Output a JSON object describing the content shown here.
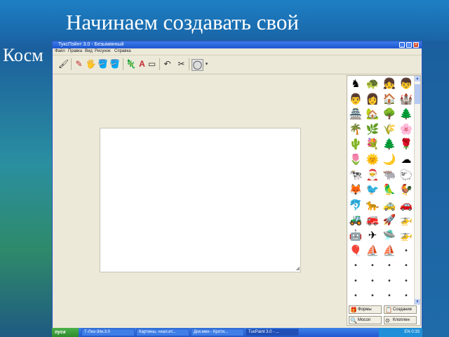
{
  "slide": {
    "title_line1": "Начинаем создавать свой",
    "title_line2": "Косм"
  },
  "window": {
    "title": "ТуксПэйнт 3.0 - Безымянный",
    "menu": [
      "Файл",
      "Правка",
      "Вид",
      "Рисунок",
      "Справка"
    ]
  },
  "toolbar": {
    "tools": [
      {
        "icon": "🖌",
        "name": "brush-tool"
      },
      {
        "icon": "✎",
        "name": "pencil-tool"
      },
      {
        "icon": "🖐",
        "name": "hand-tool"
      },
      {
        "icon": "🪣",
        "name": "fill-tool"
      },
      {
        "icon": "🦎",
        "name": "stamp-tool"
      },
      {
        "icon": "A",
        "name": "text-tool"
      },
      {
        "icon": "▭",
        "name": "shapes-tool"
      },
      {
        "icon": "↶",
        "name": "undo-tool"
      },
      {
        "icon": "✂",
        "name": "eraser-tool"
      },
      {
        "icon": "◯",
        "name": "zoom-tool"
      }
    ]
  },
  "stamps": [
    "♞",
    "🐢",
    "👧",
    "👦",
    "👨",
    "👩",
    "🏠",
    "🏰",
    "🏯",
    "🏡",
    "🌳",
    "🌲",
    "🌴",
    "🌿",
    "🌾",
    "🌸",
    "🌵",
    "💐",
    "🌲",
    "🌹",
    "🌷",
    "🌞",
    "🌙",
    "☁",
    "🐄",
    "🎅",
    "🐃",
    "🐑",
    "🦊",
    "🐦",
    "🦜",
    "🐓",
    "🐬",
    "🐆",
    "🚕",
    "🚗",
    "🚜",
    "🚒",
    "🚀",
    "🚁",
    "🤖",
    "✈",
    "🛸",
    "🚁",
    "🎈",
    "⛵",
    "⛵",
    "•",
    "•",
    "•",
    "•",
    "•",
    "•",
    "•",
    "•",
    "•",
    "•",
    "•",
    "•",
    "•"
  ],
  "palette_buttons": [
    {
      "label": "Формы",
      "icon": "🎁"
    },
    {
      "label": "Создание",
      "icon": "📋"
    },
    {
      "label": "Мосол",
      "icon": "🔍"
    },
    {
      "label": "Клоплен",
      "icon": "⊙"
    }
  ],
  "taskbar": {
    "start_label": "пуск",
    "tasks": [
      "Т-Лиз-3/м.3.0",
      "Картины, «нал.ит...",
      "Док.мен - Кроти...",
      "TuxPaint 3.0 - ..."
    ],
    "tray_text": "EN  0:33"
  }
}
